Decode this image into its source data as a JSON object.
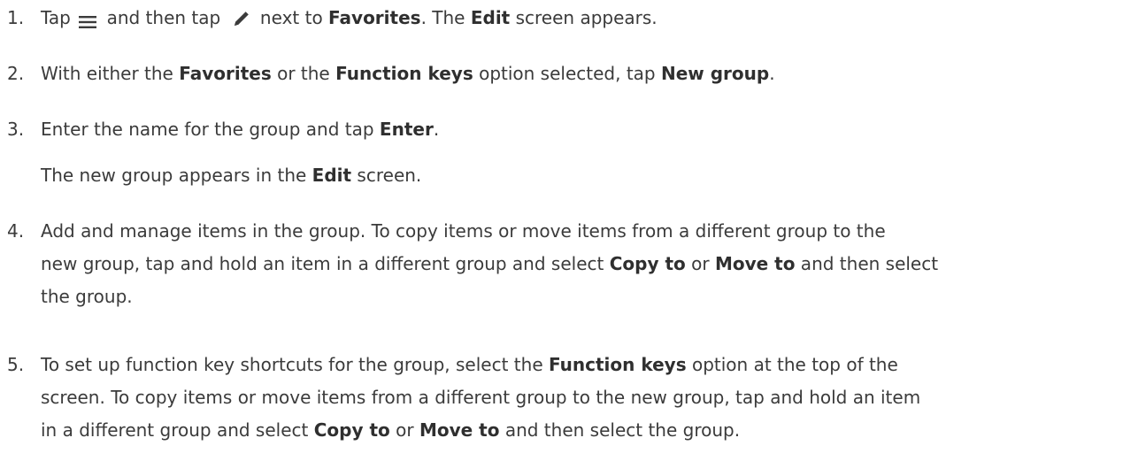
{
  "steps": [
    {
      "number": "1.",
      "t1": "Tap ",
      "icon1": "menu-icon",
      "t2": " and then tap ",
      "icon2": "pencil-icon",
      "t3": " next to ",
      "b1": "Favorites",
      "t4": ". The ",
      "b2": "Edit",
      "t5": " screen appears."
    },
    {
      "number": "2.",
      "t1": "With either the ",
      "b1": "Favorites",
      "t2": " or the ",
      "b2": "Function keys",
      "t3": " option selected, tap ",
      "b3": "New group",
      "t4": "."
    },
    {
      "number": "3.",
      "t1": "Enter the name for the group and tap ",
      "b1": "Enter",
      "t2": ".",
      "note_t1": "The new group appears in the ",
      "note_b1": "Edit",
      "note_t2": " screen."
    },
    {
      "number": "4.",
      "line1": "Add and manage items in the group. To copy items or move items from a different group to the",
      "l2_t1": "new group, tap and hold an item in a different group and select ",
      "l2_b1": "Copy to",
      "l2_t2": " or ",
      "l2_b2": "Move to",
      "l2_t3": " and then select",
      "line3": "the group."
    },
    {
      "number": "5.",
      "l1_t1": "To set up function key shortcuts for the group, select the ",
      "l1_b1": "Function keys",
      "l1_t2": " option at the top of the",
      "line2": "screen. To copy items or move items from a different group to the new group, tap and hold an item",
      "l3_t1": "in a different group and select ",
      "l3_b1": "Copy to",
      "l3_t2": " or ",
      "l3_b2": "Move to",
      "l3_t3": " and then select the group."
    }
  ],
  "colors": {
    "text": "#3b3b3b",
    "bold_text": "#2f2f2f",
    "background": "#ffffff"
  }
}
